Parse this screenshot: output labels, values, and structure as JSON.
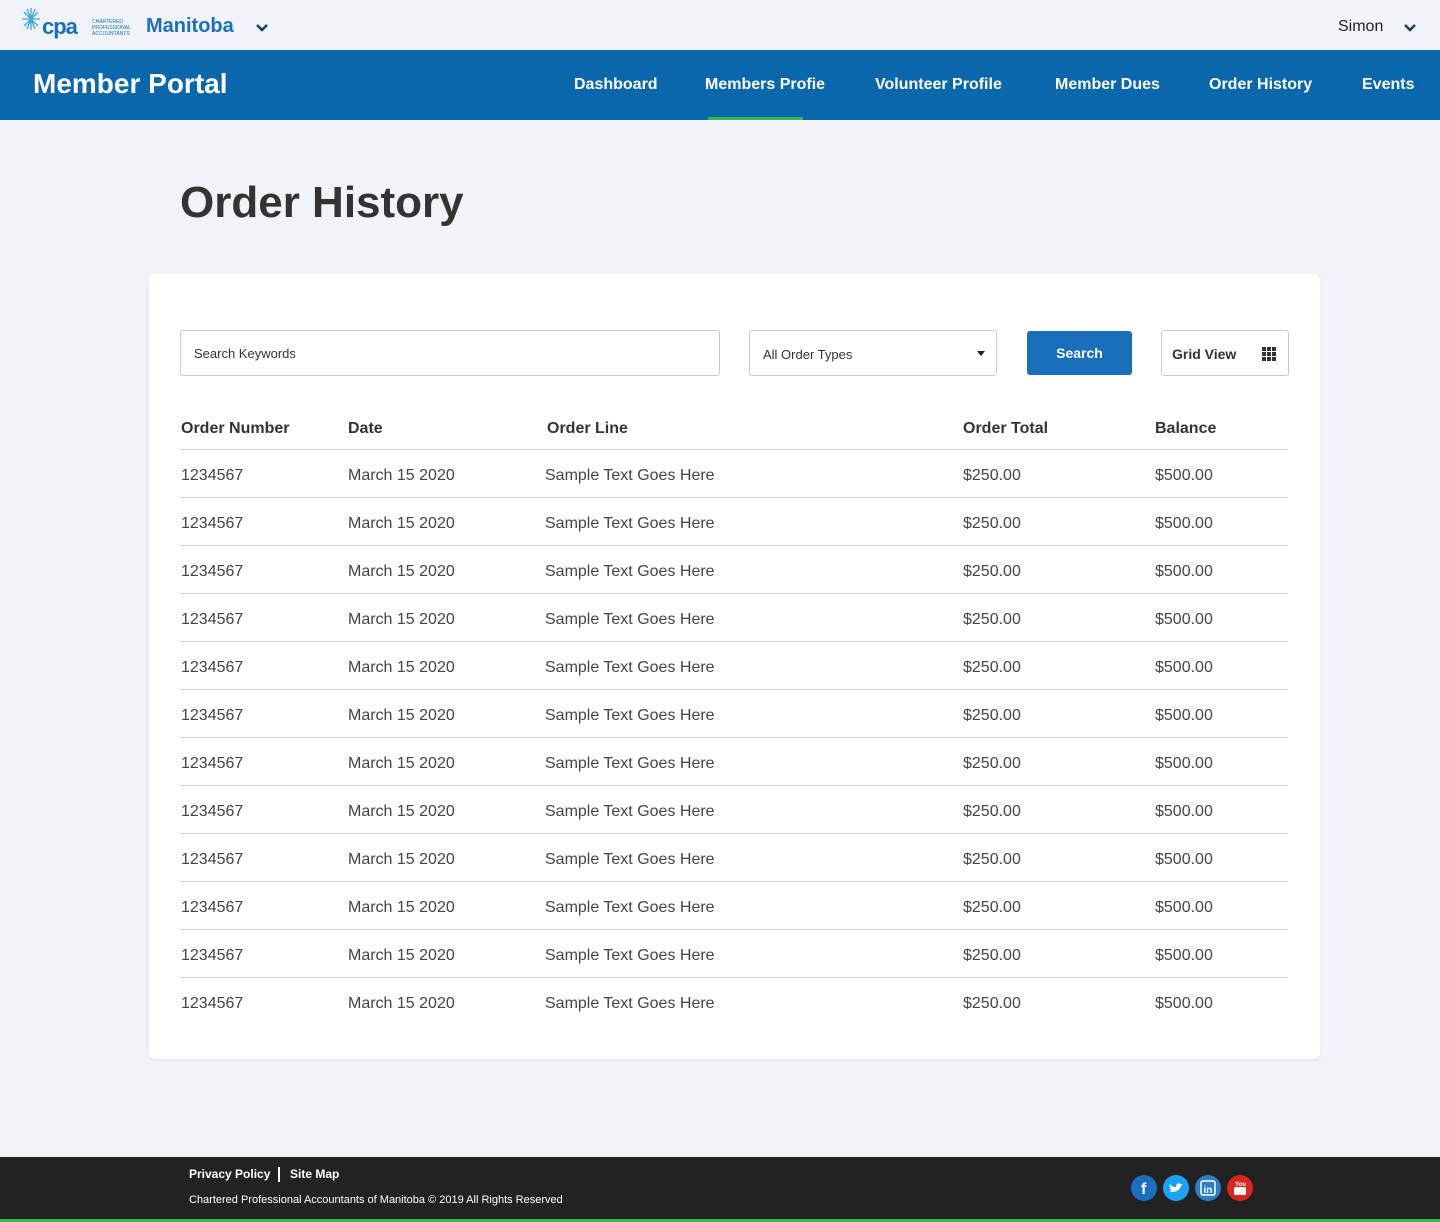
{
  "header": {
    "logo_text": "cpa",
    "logo_subtext": "Chartered Professional Accountants",
    "region": "Manitoba",
    "user": "Simon"
  },
  "nav": {
    "portal_title": "Member Portal",
    "items": [
      "Dashboard",
      "Members Profie",
      "Volunteer Profile",
      "Member Dues",
      "Order History",
      "Events"
    ],
    "active": "Members Profie"
  },
  "page": {
    "title": "Order History"
  },
  "filters": {
    "search_placeholder": "Search Keywords",
    "order_type": "All Order Types",
    "search_button": "Search",
    "view_button": "Grid View"
  },
  "table": {
    "headers": [
      "Order Number",
      "Date",
      "Order Line",
      "Order Total",
      "Balance"
    ],
    "rows": [
      [
        "1234567",
        "March 15 2020",
        "Sample Text Goes Here",
        "$250.00",
        "$500.00"
      ],
      [
        "1234567",
        "March 15 2020",
        "Sample Text Goes Here",
        "$250.00",
        "$500.00"
      ],
      [
        "1234567",
        "March 15 2020",
        "Sample Text Goes Here",
        "$250.00",
        "$500.00"
      ],
      [
        "1234567",
        "March 15 2020",
        "Sample Text Goes Here",
        "$250.00",
        "$500.00"
      ],
      [
        "1234567",
        "March 15 2020",
        "Sample Text Goes Here",
        "$250.00",
        "$500.00"
      ],
      [
        "1234567",
        "March 15 2020",
        "Sample Text Goes Here",
        "$250.00",
        "$500.00"
      ],
      [
        "1234567",
        "March 15 2020",
        "Sample Text Goes Here",
        "$250.00",
        "$500.00"
      ],
      [
        "1234567",
        "March 15 2020",
        "Sample Text Goes Here",
        "$250.00",
        "$500.00"
      ],
      [
        "1234567",
        "March 15 2020",
        "Sample Text Goes Here",
        "$250.00",
        "$500.00"
      ],
      [
        "1234567",
        "March 15 2020",
        "Sample Text Goes Here",
        "$250.00",
        "$500.00"
      ],
      [
        "1234567",
        "March 15 2020",
        "Sample Text Goes Here",
        "$250.00",
        "$500.00"
      ],
      [
        "1234567",
        "March 15 2020",
        "Sample Text Goes Here",
        "$250.00",
        "$500.00"
      ]
    ]
  },
  "footer": {
    "links": [
      "Privacy Policy",
      "Site Map"
    ],
    "copyright": "Chartered Professional Accountants of Manitoba © 2019 All Rights Reserved",
    "social": [
      {
        "icon": "facebook-icon",
        "color": "#1a6fbd"
      },
      {
        "icon": "twitter-icon",
        "color": "#1da1f2"
      },
      {
        "icon": "linkedin-icon",
        "color": "#2a7ec3"
      },
      {
        "icon": "youtube-icon",
        "color": "#d8261f"
      }
    ]
  },
  "colors": {
    "primary": "#0a67ab",
    "button": "#1a6fbd",
    "accent": "#3db54a",
    "background": "#f0f3f8",
    "footer": "#222222"
  }
}
